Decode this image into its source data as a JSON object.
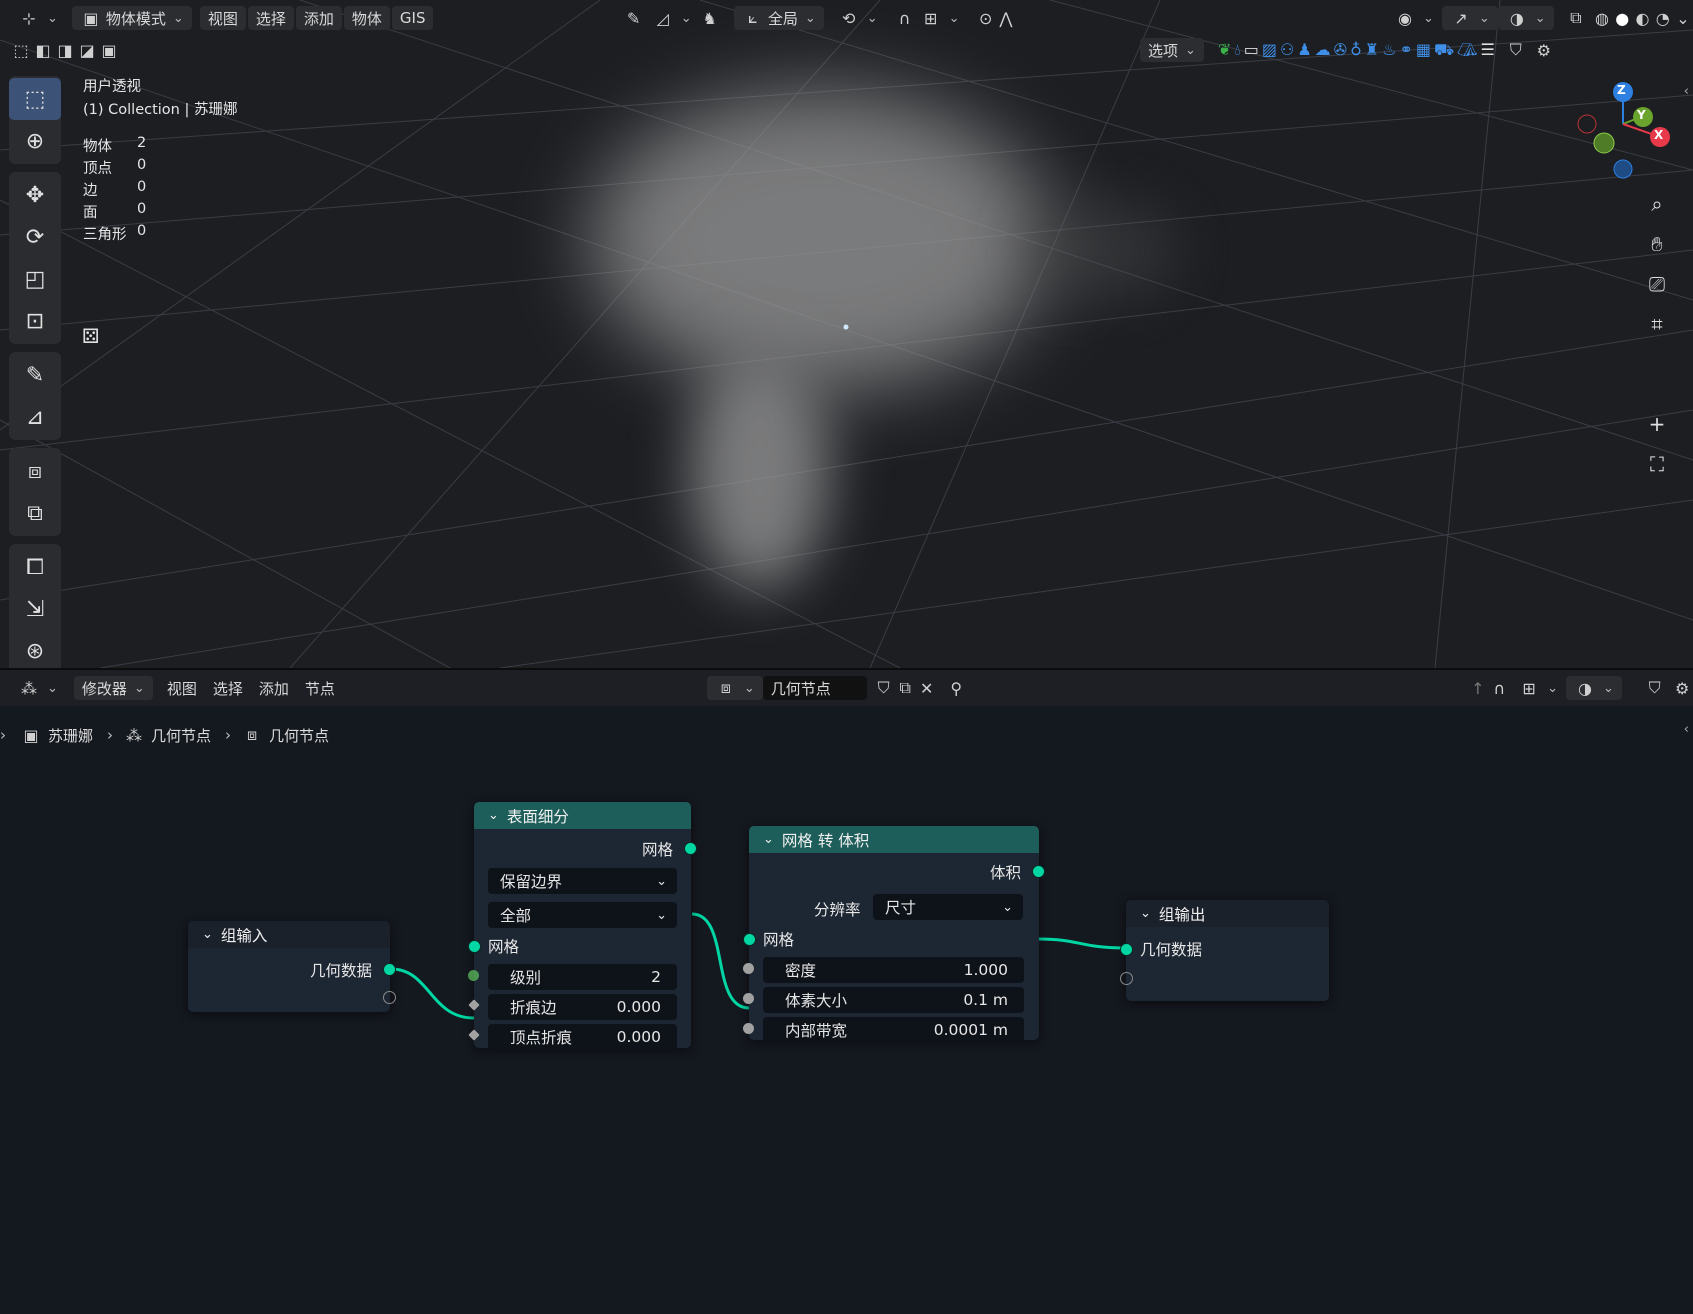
{
  "viewport_header": {
    "mode": "物体模式",
    "menu": [
      "视图",
      "选择",
      "添加",
      "物体",
      "GIS"
    ],
    "transform_orientation": "全局",
    "options": "选项"
  },
  "viewport": {
    "view_name": "用户透视",
    "collection": "(1) Collection | 苏珊娜",
    "stats": [
      {
        "label": "物体",
        "value": "2"
      },
      {
        "label": "顶点",
        "value": "0"
      },
      {
        "label": "边",
        "value": "0"
      },
      {
        "label": "面",
        "value": "0"
      },
      {
        "label": "三角形",
        "value": "0"
      }
    ],
    "gizmo": {
      "z": "Z",
      "y": "Y",
      "x": "X"
    }
  },
  "node_editor_header": {
    "editor_type": "修改器",
    "menu": [
      "视图",
      "选择",
      "添加",
      "节点"
    ],
    "node_tree": "几何节点"
  },
  "breadcrumb": [
    "苏珊娜",
    "几何节点",
    "几何节点"
  ],
  "nodes": {
    "group_input": {
      "title": "组输入",
      "output": "几何数据"
    },
    "subdivide": {
      "title": "表面细分",
      "output": "网格",
      "uv_smooth": "保留边界",
      "boundary": "全部",
      "input_mesh": "网格",
      "level_label": "级别",
      "level_value": "2",
      "edge_crease_label": "折痕边",
      "edge_crease_value": "0.000",
      "vertex_crease_label": "顶点折痕",
      "vertex_crease_value": "0.000"
    },
    "mesh_to_volume": {
      "title": "网格 转 体积",
      "output": "体积",
      "resolution_label": "分辨率",
      "resolution_value": "尺寸",
      "input_mesh": "网格",
      "density_label": "密度",
      "density_value": "1.000",
      "voxel_label": "体素大小",
      "voxel_value": "0.1 m",
      "band_label": "内部带宽",
      "band_value": "0.0001 m"
    },
    "group_output": {
      "title": "组输出",
      "input": "几何数据"
    }
  },
  "colors": {
    "geometry_socket": "#00d6a3",
    "node_header": "#1e5e5a",
    "active_tool": "#3c5276",
    "axis_x": "#e8394a",
    "axis_y": "#6aa42c",
    "axis_z": "#2d7fe0"
  }
}
